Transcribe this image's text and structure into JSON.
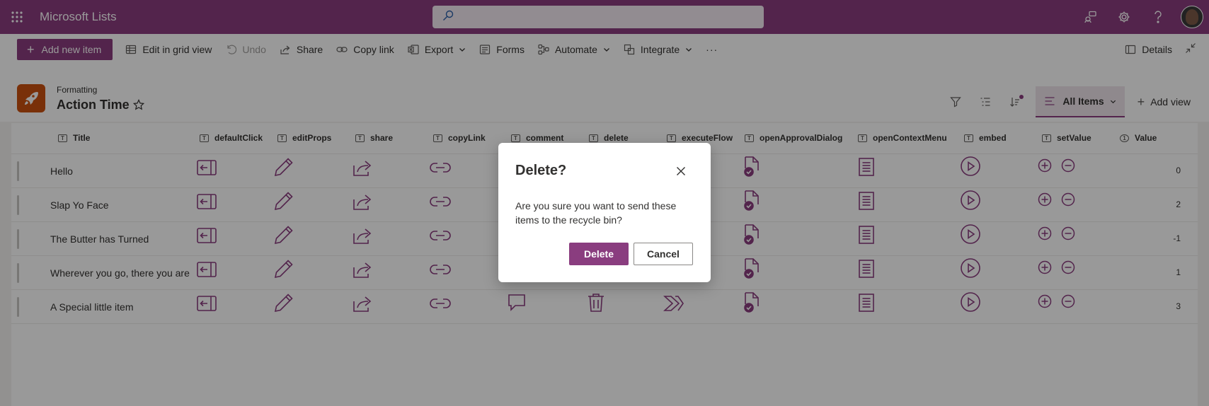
{
  "suite": {
    "app_title": "Microsoft Lists",
    "search_placeholder": ""
  },
  "commandbar": {
    "add_new_item": "Add new item",
    "edit_grid": "Edit in grid view",
    "undo": "Undo",
    "share": "Share",
    "copy_link": "Copy link",
    "export": "Export",
    "forms": "Forms",
    "automate": "Automate",
    "integrate": "Integrate",
    "more": "···",
    "details": "Details"
  },
  "list": {
    "subtitle": "Formatting",
    "title": "Action Time",
    "view_tab": "All Items",
    "add_view": "Add view"
  },
  "columns": [
    "Title",
    "defaultClick",
    "editProps",
    "share",
    "copyLink",
    "comment",
    "delete",
    "executeFlow",
    "openApprovalDialog",
    "openContextMenu",
    "embed",
    "setValue",
    "Value"
  ],
  "rows": [
    {
      "title": "Hello",
      "value": "0"
    },
    {
      "title": "Slap Yo Face",
      "value": "2"
    },
    {
      "title": "The Butter has Turned",
      "value": "-1"
    },
    {
      "title": "Wherever you go, there you are",
      "value": "1"
    },
    {
      "title": "A Special little item",
      "value": "3"
    }
  ],
  "dialog": {
    "title": "Delete?",
    "body": "Are you sure you want to send these items to the recycle bin?",
    "confirm": "Delete",
    "cancel": "Cancel"
  },
  "colors": {
    "brand": "#8a3d7f",
    "list_icon": "#ca5010"
  }
}
